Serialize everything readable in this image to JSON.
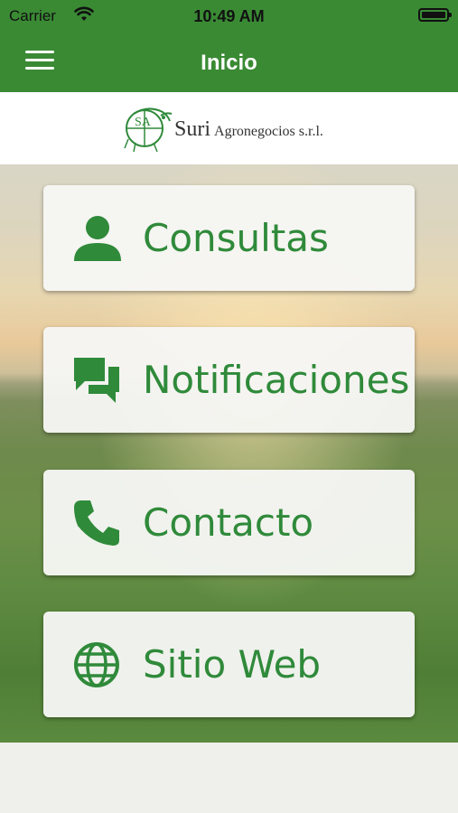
{
  "status_bar": {
    "carrier": "Carrier",
    "time": "10:49 AM"
  },
  "nav": {
    "title": "Inicio"
  },
  "logo": {
    "letters": "SA",
    "brand": "Suri",
    "subtitle": "Agronegocios s.r.l."
  },
  "menu": [
    {
      "label": "Consultas",
      "icon": "person-icon"
    },
    {
      "label": "Notificaciones",
      "icon": "chat-icon"
    },
    {
      "label": "Contacto",
      "icon": "phone-icon"
    },
    {
      "label": "Sitio Web",
      "icon": "globe-icon"
    }
  ],
  "colors": {
    "primary": "#3a8a34",
    "accent": "#2f8a3a"
  }
}
